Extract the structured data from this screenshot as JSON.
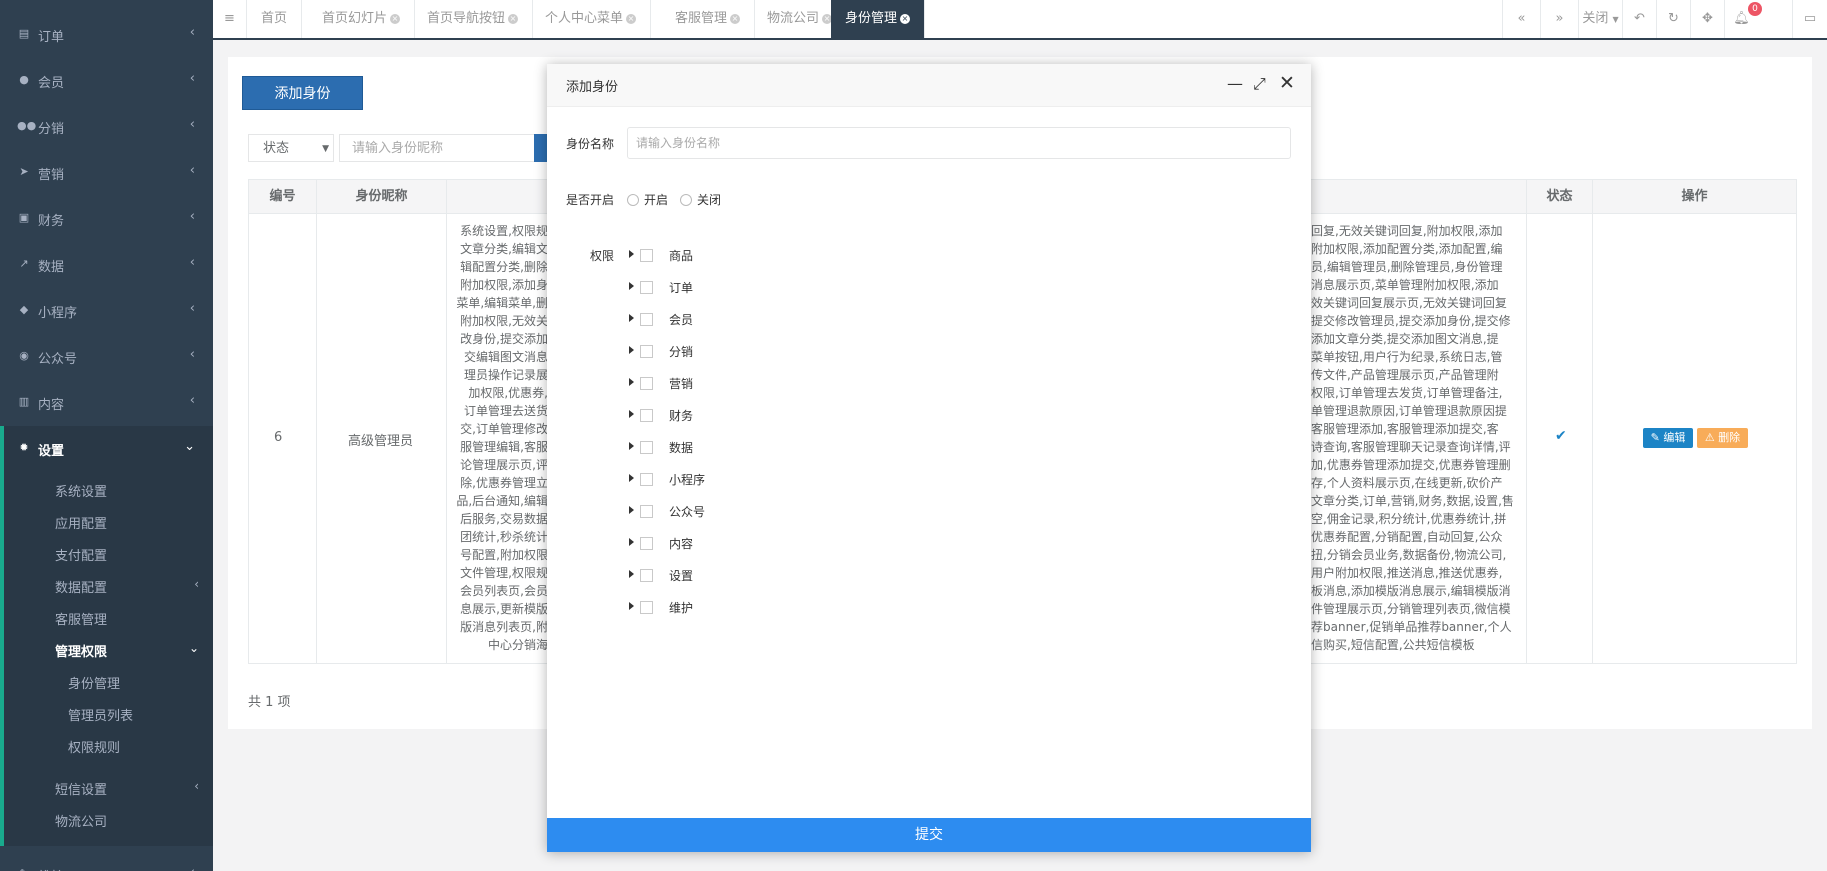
{
  "sidebar": {
    "items": [
      {
        "icon": "list-icon",
        "label": "订单"
      },
      {
        "icon": "user-icon",
        "label": "会员"
      },
      {
        "icon": "users-icon",
        "label": "分销"
      },
      {
        "icon": "send-icon",
        "label": "营销"
      },
      {
        "icon": "money-icon",
        "label": "财务"
      },
      {
        "icon": "chart-line-icon",
        "label": "数据"
      },
      {
        "icon": "cubes-icon",
        "label": "小程序"
      },
      {
        "icon": "wechat-icon",
        "label": "公众号"
      },
      {
        "icon": "book-icon",
        "label": "内容"
      },
      {
        "icon": "gear-icon",
        "label": "设置"
      }
    ],
    "settings_sub": [
      "系统设置",
      "应用配置",
      "支付配置",
      "数据配置",
      "客服管理",
      "管理权限"
    ],
    "perm_sub": [
      "身份管理",
      "管理员列表",
      "权限规则"
    ],
    "more_sub": [
      "短信设置",
      "物流公司"
    ],
    "bottom_item": "维护"
  },
  "tabs": {
    "menu_icon": "hamburger-icon",
    "items": [
      {
        "label": "首页",
        "closable": false
      },
      {
        "label": "首页幻灯片",
        "closable": true
      },
      {
        "label": "首页导航按钮",
        "closable": true
      },
      {
        "label": "个人中心菜单",
        "closable": true
      },
      {
        "label": "客服管理",
        "closable": true
      },
      {
        "label": "物流公司",
        "closable": true
      },
      {
        "label": "身份管理",
        "closable": true,
        "active": true
      }
    ],
    "close_menu_label": "关闭",
    "notification_count": "0"
  },
  "toolbar": {
    "add_button": "添加身份",
    "status_select": "状态",
    "search_placeholder": "请输入身份昵称"
  },
  "table": {
    "headers": [
      "编号",
      "身份昵称",
      "状态",
      "操作"
    ],
    "row": {
      "id": "6",
      "name": "高级管理员",
      "perm_left": [
        "系统设置,权限规",
        "文章分类,编辑文",
        "辑配置分类,删除",
        "附加权限,添加身",
        "菜单,编辑菜单,删",
        "附加权限,无效关",
        "改身份,提交添加",
        "交编辑图文消息",
        "理员操作记录展",
        "加权限,优惠券,",
        "订单管理去送货",
        "交,订单管理修改",
        "服管理编辑,客服",
        "论管理展示页,评",
        "除,优惠券管理立",
        "品,后台通知,编辑",
        "后服务,交易数据",
        "团统计,秒杀统计",
        "号配置,附加权限",
        "文件管理,权限规",
        "会员列表页,会员",
        "息展示,更新模版",
        "版消息列表页,附",
        "中心分销海"
      ],
      "perm_right": [
        "回复,无效关键词回复,附加权限,添加",
        "附加权限,添加配置分类,添加配置,编",
        "员,编辑管理员,删除管理员,身份管理",
        "消息展示页,菜单管理附加权限,添加",
        "效关键词回复展示页,无效关键词回复",
        "提交修改管理员,提交添加身份,提交修",
        "添加文章分类,提交添加图文消息,提",
        "菜单按钮,用户行为纪录,系统日志,管",
        "传文件,产品管理展示页,产品管理附",
        "权限,订单管理去发货,订单管理备注,",
        "单管理退款原因,订单管理退款原因提",
        "客服管理添加,客服管理添加提交,客",
        "诗查询,客服管理聊天记录查询详情,评",
        "加,优惠券管理添加提交,优惠券管理删",
        "存,个人资料展示页,在线更新,砍价产",
        "文章分类,订单,营销,财务,数据,设置,售",
        "空,佣金记录,积分统计,优惠券统计,拼",
        "优惠券配置,分销配置,自动回复,公众",
        "扭,分销会员业务,数据备份,物流公司,",
        "用户附加权限,推送消息,推送优惠券,",
        "板消息,添加模版消息展示,编辑模版消",
        "件管理展示页,分销管理列表页,微信模",
        "荐banner,促销单品推荐banner,个人",
        "信购买,短信配置,公共短信模板"
      ],
      "edit_label": "编辑",
      "delete_label": "删除"
    },
    "total": "共 1 项"
  },
  "modal": {
    "title": "添加身份",
    "name_label": "身份名称",
    "name_placeholder": "请输入身份名称",
    "enable_label": "是否开启",
    "radio_on": "开启",
    "radio_off": "关闭",
    "perm_label": "权限",
    "perm_tree": [
      "商品",
      "订单",
      "会员",
      "分销",
      "营销",
      "财务",
      "数据",
      "小程序",
      "公众号",
      "内容",
      "设置",
      "维护"
    ],
    "submit": "提交"
  }
}
